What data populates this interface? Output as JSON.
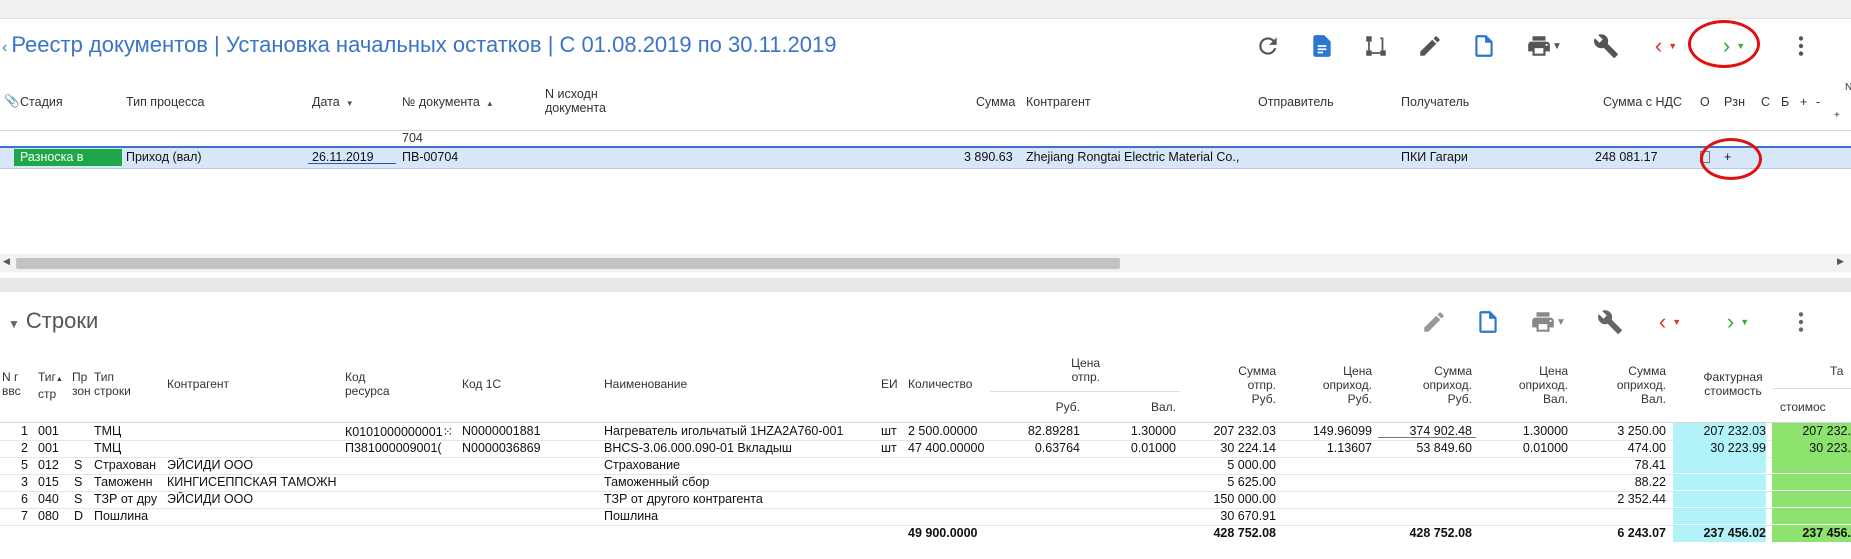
{
  "header": {
    "title": "Реестр документов | Установка начальных остатков | С 01.08.2019 по 30.11.2019"
  },
  "toolbar_icons": [
    "refresh-icon",
    "document-icon",
    "workflow-icon",
    "edit-icon",
    "new-document-icon",
    "print-icon",
    "wrench-icon",
    "prev-icon",
    "next-icon",
    "more-icon"
  ],
  "colors": {
    "accent": "#3a73c8",
    "stage_green": "#1fa84a",
    "selected_row": "#d7e6f8",
    "cyan_cell": "#b2f3fa",
    "green_cell": "#8ee36e",
    "annotation_red": "#e01010",
    "prev_red": "#e03030",
    "next_green": "#3aa83a"
  },
  "documents": {
    "columns": {
      "stage": "Стадия",
      "process_type": "Тип процесса",
      "date": "Дата",
      "doc_number": "№ документа",
      "orig_number_1": "N исходн",
      "orig_number_2": "документа",
      "sum": "Сумма",
      "counterparty": "Контрагент",
      "sender": "Отправитель",
      "receiver": "Получатель",
      "sum_vat": "Сумма с НДС",
      "o": "О",
      "rzn": "Рзн",
      "s": "С",
      "b": "Б",
      "plus": "+",
      "minus": "-",
      "n": "N",
      "plus2": "+"
    },
    "filter_doc_number": "704",
    "row": {
      "stage": "Разноска в",
      "process_type": "Приход (вал)",
      "date": "26.11.2019",
      "doc_number": "ПВ-00704",
      "sum": "3 890.63",
      "counterparty": "Zhejiang Rongtai Electric Material Co.,",
      "receiver": "ПКИ Гагари",
      "sum_vat": "248 081.17",
      "rzn": "+"
    }
  },
  "lines": {
    "title": "Строки",
    "columns": {
      "n_1": "N г",
      "n_2": "ввс",
      "type_1": "Тиг",
      "type_2": "стр",
      "pr_1": "Пр",
      "pr_2": "зон",
      "row_type_1": "Тип",
      "row_type_2": "строки",
      "counterparty": "Контрагент",
      "res_code_1": "Код",
      "res_code_2": "ресурса",
      "code1c": "Код 1С",
      "name": "Наименование",
      "unit": "ЕИ",
      "qty": "Количество",
      "price_1": "Цена",
      "price_2": "отпр.",
      "price_rub": "Руб.",
      "price_val": "Вал.",
      "sum_out_1": "Сумма",
      "sum_out_2": "отпр.",
      "sum_out_3": "Руб.",
      "price_in_rub_1": "Цена",
      "price_in_rub_2": "оприход.",
      "price_in_rub_3": "Руб.",
      "sum_in_rub_1": "Сумма",
      "sum_in_rub_2": "оприход.",
      "sum_in_rub_3": "Руб.",
      "price_in_val_1": "Цена",
      "price_in_val_2": "оприход.",
      "price_in_val_3": "Вал.",
      "sum_in_val_1": "Сумма",
      "sum_in_val_2": "оприход.",
      "sum_in_val_3": "Вал.",
      "invoice_1": "Фактурная",
      "invoice_2": "стоимость",
      "ta_1": "Та",
      "ta_2": "стоимос"
    },
    "rows": [
      {
        "n": "1",
        "type": "001",
        "pr": "",
        "row_type": "ТМЦ",
        "counterparty": "",
        "res_code": "К0101000000001⁙",
        "code1c": "N0000001881",
        "name": "Нагреватель игольчатый 1HZA2A760-001",
        "unit": "шт",
        "qty": "2 500.00000",
        "price_rub": "82.89281",
        "price_val": "1.30000",
        "sum_out": "207 232.03",
        "price_in_rub": "149.96099",
        "sum_in_rub": "374 902.48",
        "price_in_val": "1.30000",
        "sum_in_val": "3 250.00",
        "invoice": "207 232.03",
        "ta": "207 232."
      },
      {
        "n": "2",
        "type": "001",
        "pr": "",
        "row_type": "ТМЦ",
        "counterparty": "",
        "res_code": "П381000009001(",
        "code1c": "N0000036869",
        "name": "BHCS-3.06.000.090-01 Вкладыш",
        "unit": "шт",
        "qty": "47 400.00000",
        "price_rub": "0.63764",
        "price_val": "0.01000",
        "sum_out": "30 224.14",
        "price_in_rub": "1.13607",
        "sum_in_rub": "53 849.60",
        "price_in_val": "0.01000",
        "sum_in_val": "474.00",
        "invoice": "30 223.99",
        "ta": "30 223."
      },
      {
        "n": "5",
        "type": "012",
        "pr": "S",
        "row_type": "Страхован",
        "counterparty": "ЭЙСИДИ ООО",
        "res_code": "",
        "code1c": "",
        "name": "Страхование",
        "unit": "",
        "qty": "",
        "price_rub": "",
        "price_val": "",
        "sum_out": "5 000.00",
        "price_in_rub": "",
        "sum_in_rub": "",
        "price_in_val": "",
        "sum_in_val": "78.41",
        "invoice": "",
        "ta": ""
      },
      {
        "n": "3",
        "type": "015",
        "pr": "S",
        "row_type": "Таможенн",
        "counterparty": "КИНГИСЕППСКАЯ ТАМОЖН",
        "res_code": "",
        "code1c": "",
        "name": "Таможенный сбор",
        "unit": "",
        "qty": "",
        "price_rub": "",
        "price_val": "",
        "sum_out": "5 625.00",
        "price_in_rub": "",
        "sum_in_rub": "",
        "price_in_val": "",
        "sum_in_val": "88.22",
        "invoice": "",
        "ta": ""
      },
      {
        "n": "6",
        "type": "040",
        "pr": "S",
        "row_type": "ТЗР от дру",
        "counterparty": "ЭЙСИДИ ООО",
        "res_code": "",
        "code1c": "",
        "name": "ТЗР от другого контрагента",
        "unit": "",
        "qty": "",
        "price_rub": "",
        "price_val": "",
        "sum_out": "150 000.00",
        "price_in_rub": "",
        "sum_in_rub": "",
        "price_in_val": "",
        "sum_in_val": "2 352.44",
        "invoice": "",
        "ta": ""
      },
      {
        "n": "7",
        "type": "080",
        "pr": "D",
        "row_type": "Пошлина",
        "counterparty": "",
        "res_code": "",
        "code1c": "",
        "name": "Пошлина",
        "unit": "",
        "qty": "",
        "price_rub": "",
        "price_val": "",
        "sum_out": "30 670.91",
        "price_in_rub": "",
        "sum_in_rub": "",
        "price_in_val": "",
        "sum_in_val": "",
        "invoice": "",
        "ta": ""
      }
    ],
    "totals": {
      "qty": "49 900.0000",
      "sum_out": "428 752.08",
      "sum_in_rub": "428 752.08",
      "sum_in_val": "6 243.07",
      "invoice": "237 456.02",
      "ta": "237 456."
    }
  }
}
